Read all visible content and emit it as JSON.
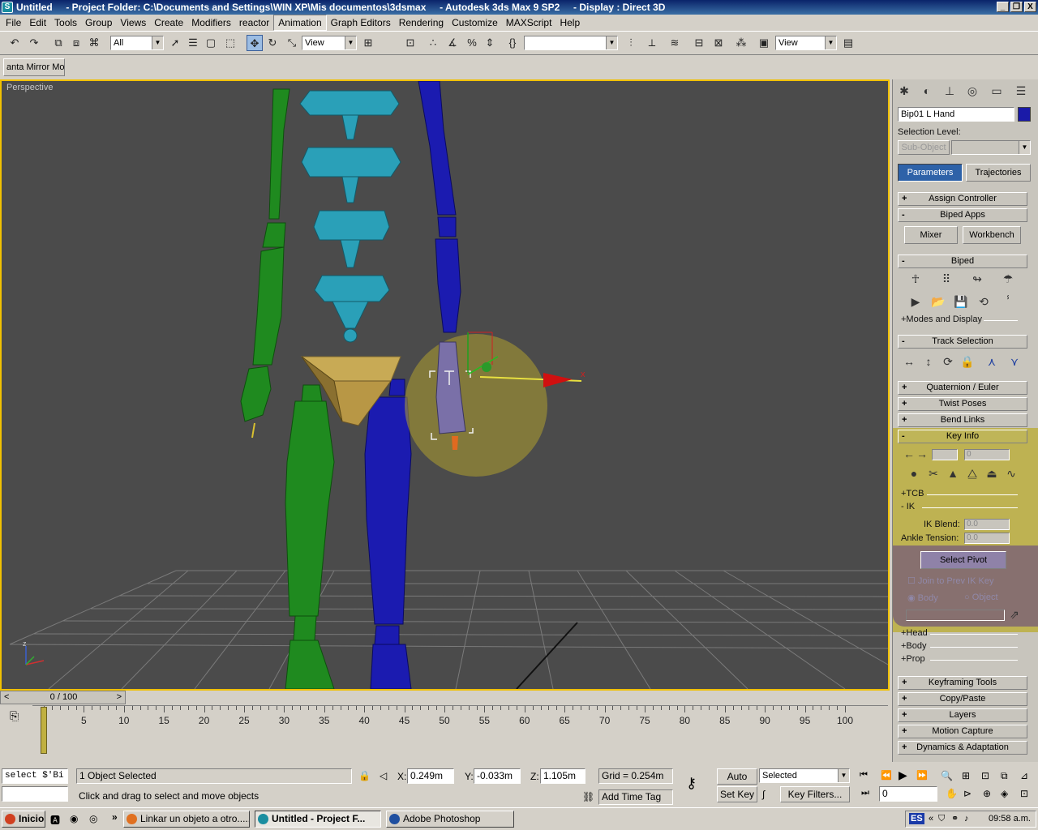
{
  "window": {
    "title": "Untitled     - Project Folder: C:\\Documents and Settings\\WIN XP\\Mis documentos\\3dsmax     - Autodesk 3ds Max 9 SP2     - Display : Direct 3D",
    "min": "_",
    "max": "❐",
    "close": "X"
  },
  "menu": [
    "File",
    "Edit",
    "Tools",
    "Group",
    "Views",
    "Create",
    "Modifiers",
    "reactor",
    "Animation",
    "Graph Editors",
    "Rendering",
    "Customize",
    "MAXScript",
    "Help"
  ],
  "toolbar": {
    "selection_filter": "All",
    "ref_coord": "View",
    "named_selection": "",
    "view_combo": "View"
  },
  "mirror_button": "anta Mirror Mor",
  "viewport": {
    "label": "Perspective",
    "axis_x": "x",
    "axis_z": "z"
  },
  "command_panel": {
    "object_name": "Bip01 L Hand",
    "object_color": "#1a1aa8",
    "selection_level_label": "Selection Level:",
    "sub_object_label": "Sub-Object",
    "tab_parameters": "Parameters",
    "tab_trajectories": "Trajectories",
    "rollups": {
      "assign_controller": "Assign Controller",
      "biped_apps": "Biped Apps",
      "mixer": "Mixer",
      "workbench": "Workbench",
      "biped": "Biped",
      "modes_display": "+Modes and Display",
      "track_selection": "Track Selection",
      "quaternion_euler": "Quaternion / Euler",
      "twist_poses": "Twist Poses",
      "bend_links": "Bend Links",
      "key_info": "Key Info",
      "tcb": "+TCB",
      "ik": "- IK",
      "ik_blend_label": "IK Blend:",
      "ik_blend_value": "0.0",
      "ankle_tension_label": "Ankle Tension:",
      "ankle_tension_value": "0.0",
      "key_value": "0",
      "select_pivot": "Select Pivot",
      "join_prev": "Join to Prev IK Key",
      "body": "Body",
      "object": "Object",
      "head": "+Head",
      "body_sec": "+Body",
      "prop": "+Prop",
      "keyframing_tools": "Keyframing Tools",
      "copy_paste": "Copy/Paste",
      "layers": "Layers",
      "motion_capture": "Motion Capture",
      "dynamics": "Dynamics & Adaptation"
    }
  },
  "timeline": {
    "slider_label": "0 / 100",
    "prev": "<",
    "next": ">",
    "ticks": [
      "0",
      "5",
      "10",
      "15",
      "20",
      "25",
      "30",
      "35",
      "40",
      "45",
      "50",
      "55",
      "60",
      "65",
      "70",
      "75",
      "80",
      "85",
      "90",
      "95",
      "100"
    ]
  },
  "status": {
    "maxscript_line": "select $'Bi",
    "selected_text": "1 Object Selected",
    "prompt": "Click and drag to select and move objects",
    "x_label": "X:",
    "x_value": "0.249m",
    "y_label": "Y:",
    "y_value": "-0.033m",
    "z_label": "Z:",
    "z_value": "1.105m",
    "grid": "Grid = 0.254m",
    "add_time_tag": "Add Time Tag",
    "auto_key": "Auto Key",
    "set_key": "Set Key",
    "selected_combo": "Selected",
    "key_filters": "Key Filters...",
    "frame": "0"
  },
  "taskbar": {
    "start": "Inicio",
    "tasks": [
      "Linkar un objeto a otro.....",
      "Untitled     - Project F...",
      "Adobe Photoshop"
    ],
    "lang": "ES",
    "time": "09:58 a.m."
  }
}
